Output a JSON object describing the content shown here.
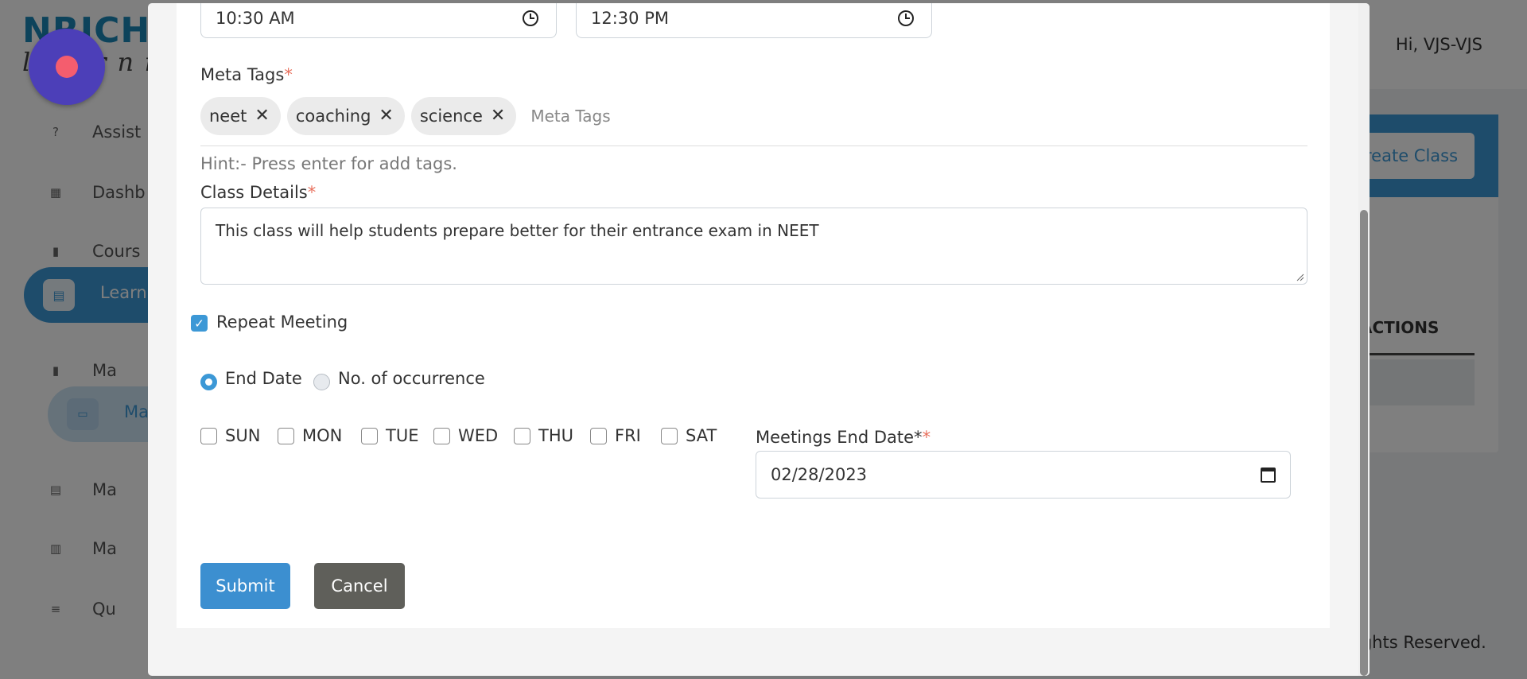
{
  "background": {
    "logo": {
      "top": "NRICH",
      "sub": "learning"
    },
    "user_greeting": "Hi, VJS-VJS",
    "sidebar": {
      "items": [
        {
          "label": "Assist",
          "icon": "help-circle-icon"
        },
        {
          "label": "Dashb",
          "icon": "dashboard-icon"
        },
        {
          "label": "Cours",
          "icon": "book-icon"
        },
        {
          "label": "Learni",
          "icon": "document-icon"
        },
        {
          "label": "Ma",
          "icon": "book-icon"
        },
        {
          "label": "Ma",
          "icon": "cast-icon"
        },
        {
          "label": "Ma",
          "icon": "document-icon"
        },
        {
          "label": "Ma",
          "icon": "chart-icon"
        },
        {
          "label": "Qu",
          "icon": "checklist-icon"
        }
      ]
    },
    "create_button": "reate Class",
    "actions_header": "ACTIONS",
    "footer": "ights Reserved."
  },
  "modal": {
    "start_time": "10:30  AM",
    "end_time": "12:30  PM",
    "meta_tags": {
      "label": "Meta Tags",
      "required_mark": "*",
      "tags": [
        "neet",
        "coaching",
        "science"
      ],
      "placeholder": "Meta Tags",
      "remove_glyph": "✕"
    },
    "hint": "Hint:- Press enter for add tags.",
    "class_details": {
      "label": "Class Details",
      "required_mark": "*",
      "value": "This class will help students prepare better for their entrance exam in NEET"
    },
    "repeat_meeting": {
      "label": "Repeat Meeting",
      "checked": true
    },
    "end_type": {
      "options": [
        "End Date",
        "No. of occurrence"
      ],
      "selected": "End Date"
    },
    "days": [
      "SUN",
      "MON",
      "TUE",
      "WED",
      "THU",
      "FRI",
      "SAT"
    ],
    "meetings_end_date": {
      "label": "Meetings End Date*",
      "required_mark": "*",
      "value": "02/28/2023"
    },
    "buttons": {
      "submit": "Submit",
      "cancel": "Cancel"
    }
  },
  "colors": {
    "primary": "#3c98d6",
    "cancel": "#5f5f5a",
    "required": "#e8705d",
    "fab": "#4c3fb8",
    "fab_dot": "#f45d6e"
  }
}
